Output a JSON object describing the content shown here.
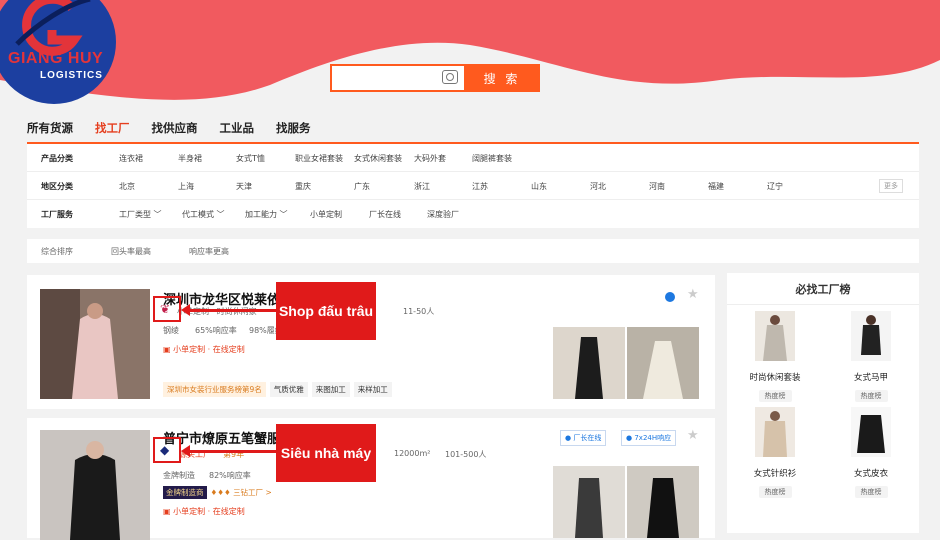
{
  "logo": {
    "title": "GIANG HUY",
    "subtitle": "LOGISTICS"
  },
  "search": {
    "button": "搜 索"
  },
  "topnav": [
    "所有货源",
    "找工厂",
    "找供应商",
    "工业品",
    "找服务"
  ],
  "filters": [
    {
      "label": "产品分类",
      "options": [
        "连衣裙",
        "半身裙",
        "女式T恤",
        "职业女裙套装",
        "女式休闲套装",
        "大码外套",
        "阔腿裤套装"
      ]
    },
    {
      "label": "地区分类",
      "options": [
        "北京",
        "上海",
        "天津",
        "重庆",
        "广东",
        "浙江",
        "江苏",
        "山东",
        "河北",
        "河南",
        "福建",
        "辽宁"
      ],
      "more": "更多"
    },
    {
      "label": "工厂服务",
      "options": [
        "工厂类型",
        "代工模式",
        "加工能力",
        "小单定制",
        "厂长在线",
        "深度验厂"
      ]
    }
  ],
  "sort": [
    "综合排序",
    "回头率最高",
    "响应率更高"
  ],
  "cards": [
    {
      "name": "深圳市龙华区悦莱依",
      "line1": "小单定制 · 时尚休闲家",
      "staff": "11-50人",
      "line2a": "65%响应率",
      "line2b": "98%履约",
      "prefix": "钢绫",
      "tags": "小单定制 · 在线定制",
      "chips": [
        "深圳市女装行业服务榜第9名",
        "气质优雅",
        "来图加工",
        "来样加工"
      ]
    },
    {
      "name": "普宁市燎原五笔蟹服",
      "badge": "源头工厂",
      "years": "第9年",
      "area": "12000m²",
      "staff": "101-500人",
      "prefix": "金牌制造",
      "line2a": "82%响应率",
      "tier": "三钻工厂 >",
      "gold": "金牌制造商",
      "tags": "小单定制 · 在线定制",
      "online": "厂长在线",
      "resp": "7x24H响应"
    }
  ],
  "callouts": [
    "Shop đấu trâu",
    "Siêu nhà máy"
  ],
  "side": {
    "title": "必找工厂榜",
    "items": [
      {
        "name": "时尚休闲套装",
        "hot": "热度榜"
      },
      {
        "name": "女式马甲",
        "hot": "热度榜"
      },
      {
        "name": "女式针织衫",
        "hot": "热度榜"
      },
      {
        "name": "女式皮衣",
        "hot": "热度榜"
      }
    ]
  }
}
